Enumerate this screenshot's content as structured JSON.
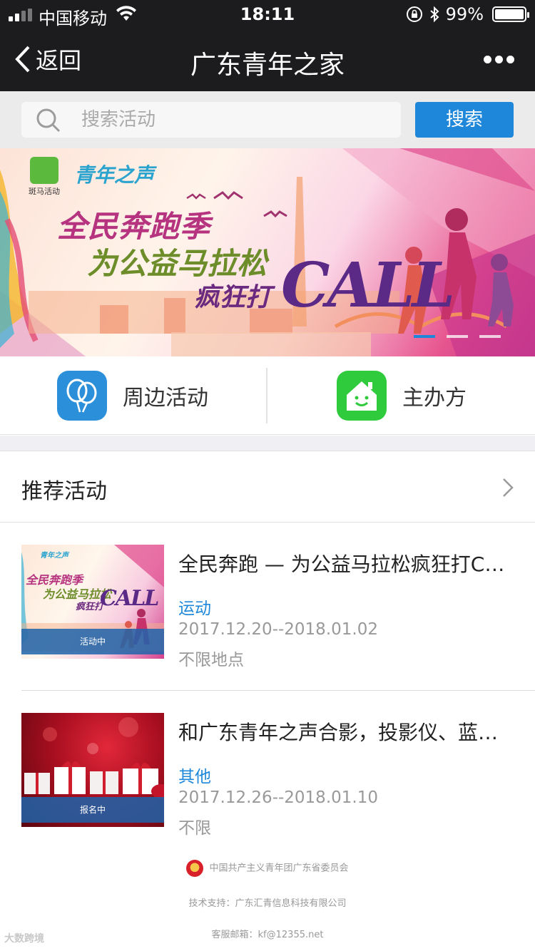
{
  "status_bar": {
    "carrier": "中国移动",
    "time": "18:11",
    "battery_text": "99%",
    "battery_level": 0.99
  },
  "nav": {
    "back_label": "返回",
    "title": "广东青年之家"
  },
  "search": {
    "placeholder": "搜索活动",
    "button_label": "搜索"
  },
  "banner": {
    "logo_text": "斑马活动",
    "brand": "青年之声",
    "line1": "全民奔跑季",
    "line2": "为公益马拉松",
    "line3": "疯狂打",
    "line3_word": "CALL",
    "active_slide": 1,
    "slide_count": 3
  },
  "quick_entries": [
    {
      "label": "周边活动",
      "icon": "balloon-icon",
      "color": "#2c8fd9"
    },
    {
      "label": "主办方",
      "icon": "home-smile-icon",
      "color": "#2fcb3c"
    }
  ],
  "recommend": {
    "title": "推荐活动"
  },
  "activities": [
    {
      "title": "全民奔跑 — 为公益马拉松疯狂打CALL",
      "category": "运动",
      "date": "2017.12.20--2018.01.02",
      "location": "不限地点",
      "status": "活动中",
      "thumb_text": {
        "brand": "青年之声",
        "line1": "全民奔跑季",
        "line2": "为公益马拉松",
        "line3": "疯狂打",
        "word": "CALL"
      }
    },
    {
      "title": "和广东青年之声合影，投影仪、蓝牙音箱等你来拿",
      "category": "其他",
      "date": "2017.12.26--2018.01.10",
      "location": "不限",
      "status": "报名中"
    }
  ],
  "footer": {
    "org": "中国共产主义青年团广东省委员会",
    "tech": "技术支持：广东汇青信息科技有限公司",
    "mail": "客服邮箱：kf@12355.net",
    "watermark": "大数跨境"
  },
  "colors": {
    "accent": "#1e87d9",
    "topbar": "#1c1c1e",
    "badge": "#1e64aa"
  }
}
